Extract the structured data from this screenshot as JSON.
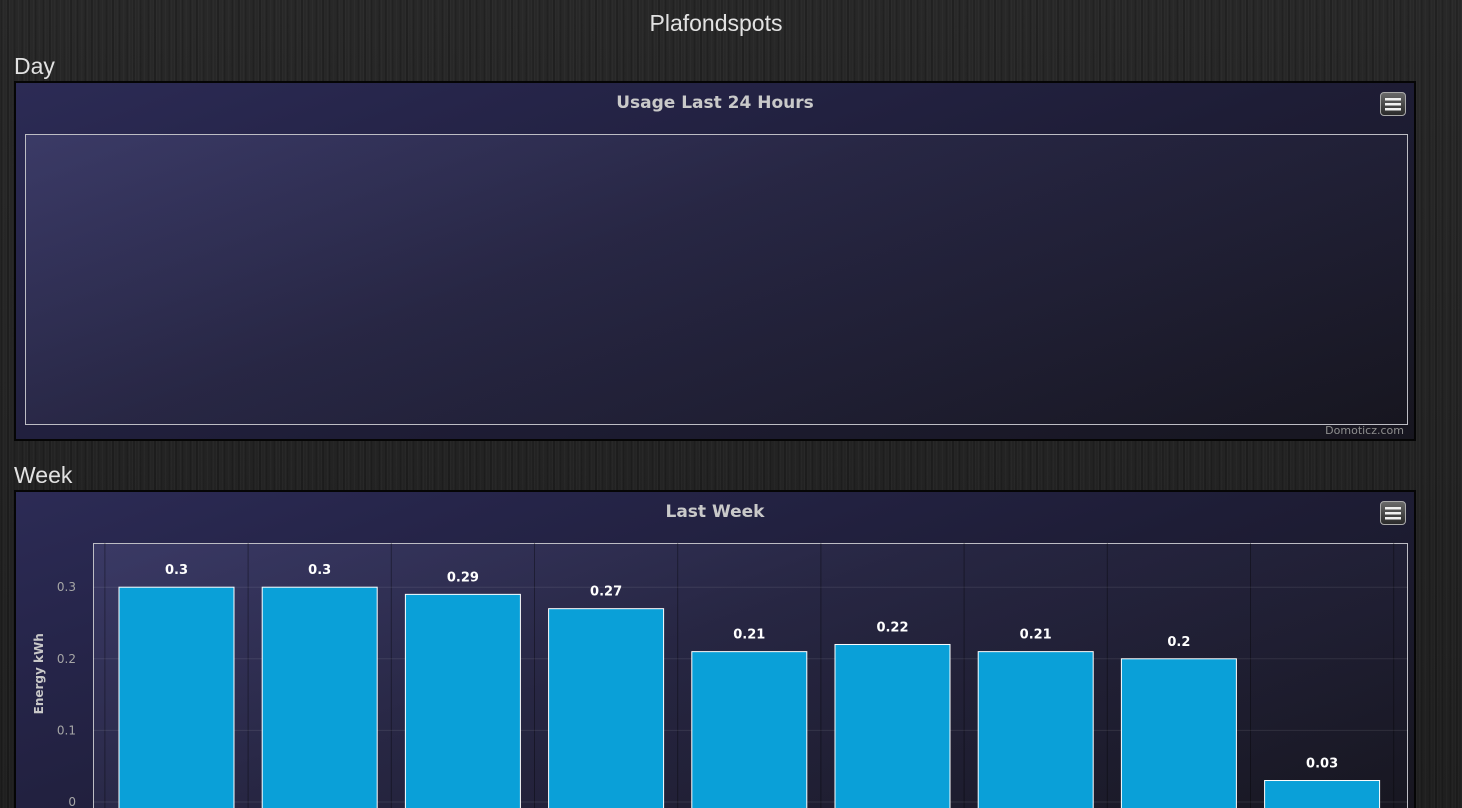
{
  "page": {
    "title": "Plafondspots"
  },
  "day_section": {
    "label": "Day",
    "chart_title": "Usage Last 24 Hours",
    "menu_icon": "hamburger-menu-icon",
    "credits": "Domoticz.com"
  },
  "week_section": {
    "label": "Week",
    "chart_title": "Last Week",
    "menu_icon": "hamburger-menu-icon"
  },
  "chart_data": [
    {
      "type": "bar",
      "title": "Usage Last 24 Hours",
      "categories": [],
      "values": []
    },
    {
      "type": "bar",
      "title": "Last Week",
      "ylabel": "Energy kWh",
      "xlabel": "",
      "ylim": [
        0,
        0.36
      ],
      "yticks": [
        0,
        0.1,
        0.2,
        0.3
      ],
      "ytick_labels": [
        "0",
        "0.1",
        "0.2",
        "0.3"
      ],
      "values": [
        0.3,
        0.3,
        0.29,
        0.27,
        0.21,
        0.22,
        0.21,
        0.2,
        0.03
      ],
      "value_labels": [
        "0.3",
        "0.3",
        "0.29",
        "0.27",
        "0.21",
        "0.22",
        "0.21",
        "0.2",
        "0.03"
      ],
      "bar_color": "#0aa0d8",
      "grid": true
    }
  ]
}
